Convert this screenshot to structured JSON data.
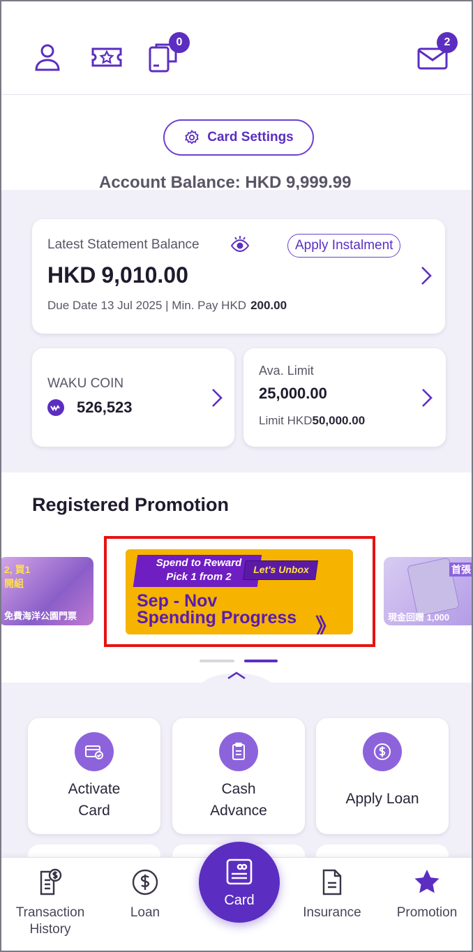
{
  "header": {
    "peek_text": "Account Balance: HKD 9,999.99",
    "icons": [
      "profile-icon",
      "coupon-star-icon",
      "wallet-device-icon",
      "mail-icon"
    ],
    "wallet_badge": "0",
    "mail_badge": "2"
  },
  "card_settings": {
    "label": "Card Settings"
  },
  "statement": {
    "label": "Latest Statement Balance",
    "apply_instalment": "Apply Instalment",
    "currency": "HKD",
    "amount": "9,010.00",
    "due_prefix": "Due Date 13 Jul 2025 | Min. Pay HKD",
    "min_pay": "200.00"
  },
  "waku_coin": {
    "label": "WAKU COIN",
    "value": "526,523"
  },
  "limit": {
    "label": "Ava. Limit",
    "value": "25,000.00",
    "sub_prefix": "Limit HKD",
    "sub_value": "50,000.00"
  },
  "promotion": {
    "title": "Registered Promotion",
    "main_banner": {
      "tag_line1": "Spend to Reward",
      "tag_line2": "Pick 1 from 2",
      "unbox": "Let's Unbox",
      "line1": "Sep - Nov",
      "line2": "Spending Progress",
      "arrow": "》"
    },
    "left_banner": {
      "top": "2, 買1",
      "top2": "開組",
      "bottom": "免費海洋公園門票"
    },
    "right_banner": {
      "top": "首張",
      "bottom": "現金回贈 1,000"
    }
  },
  "actions": [
    {
      "label_line1": "Activate",
      "label_line2": "Card",
      "icon": "activate-card-icon"
    },
    {
      "label_line1": "Cash",
      "label_line2": "Advance",
      "icon": "clipboard-icon"
    },
    {
      "label_line1": "Apply Loan",
      "label_line2": "",
      "icon": "dollar-circle-icon"
    }
  ],
  "bottom_nav": [
    {
      "label": "Transaction History",
      "icon": "transaction-history-icon"
    },
    {
      "label": "Loan",
      "icon": "dollar-circle-icon"
    },
    {
      "label": "Card",
      "icon": "card-icon",
      "active": true
    },
    {
      "label": "Insurance",
      "icon": "document-icon"
    },
    {
      "label": "Promotion",
      "icon": "star-icon"
    }
  ],
  "colors": {
    "primary": "#5b2ec1",
    "accent_light": "#8d63dc",
    "bg_lavender": "#f1eff7",
    "highlight": "#e41313",
    "banner_yellow": "#f6b300"
  }
}
